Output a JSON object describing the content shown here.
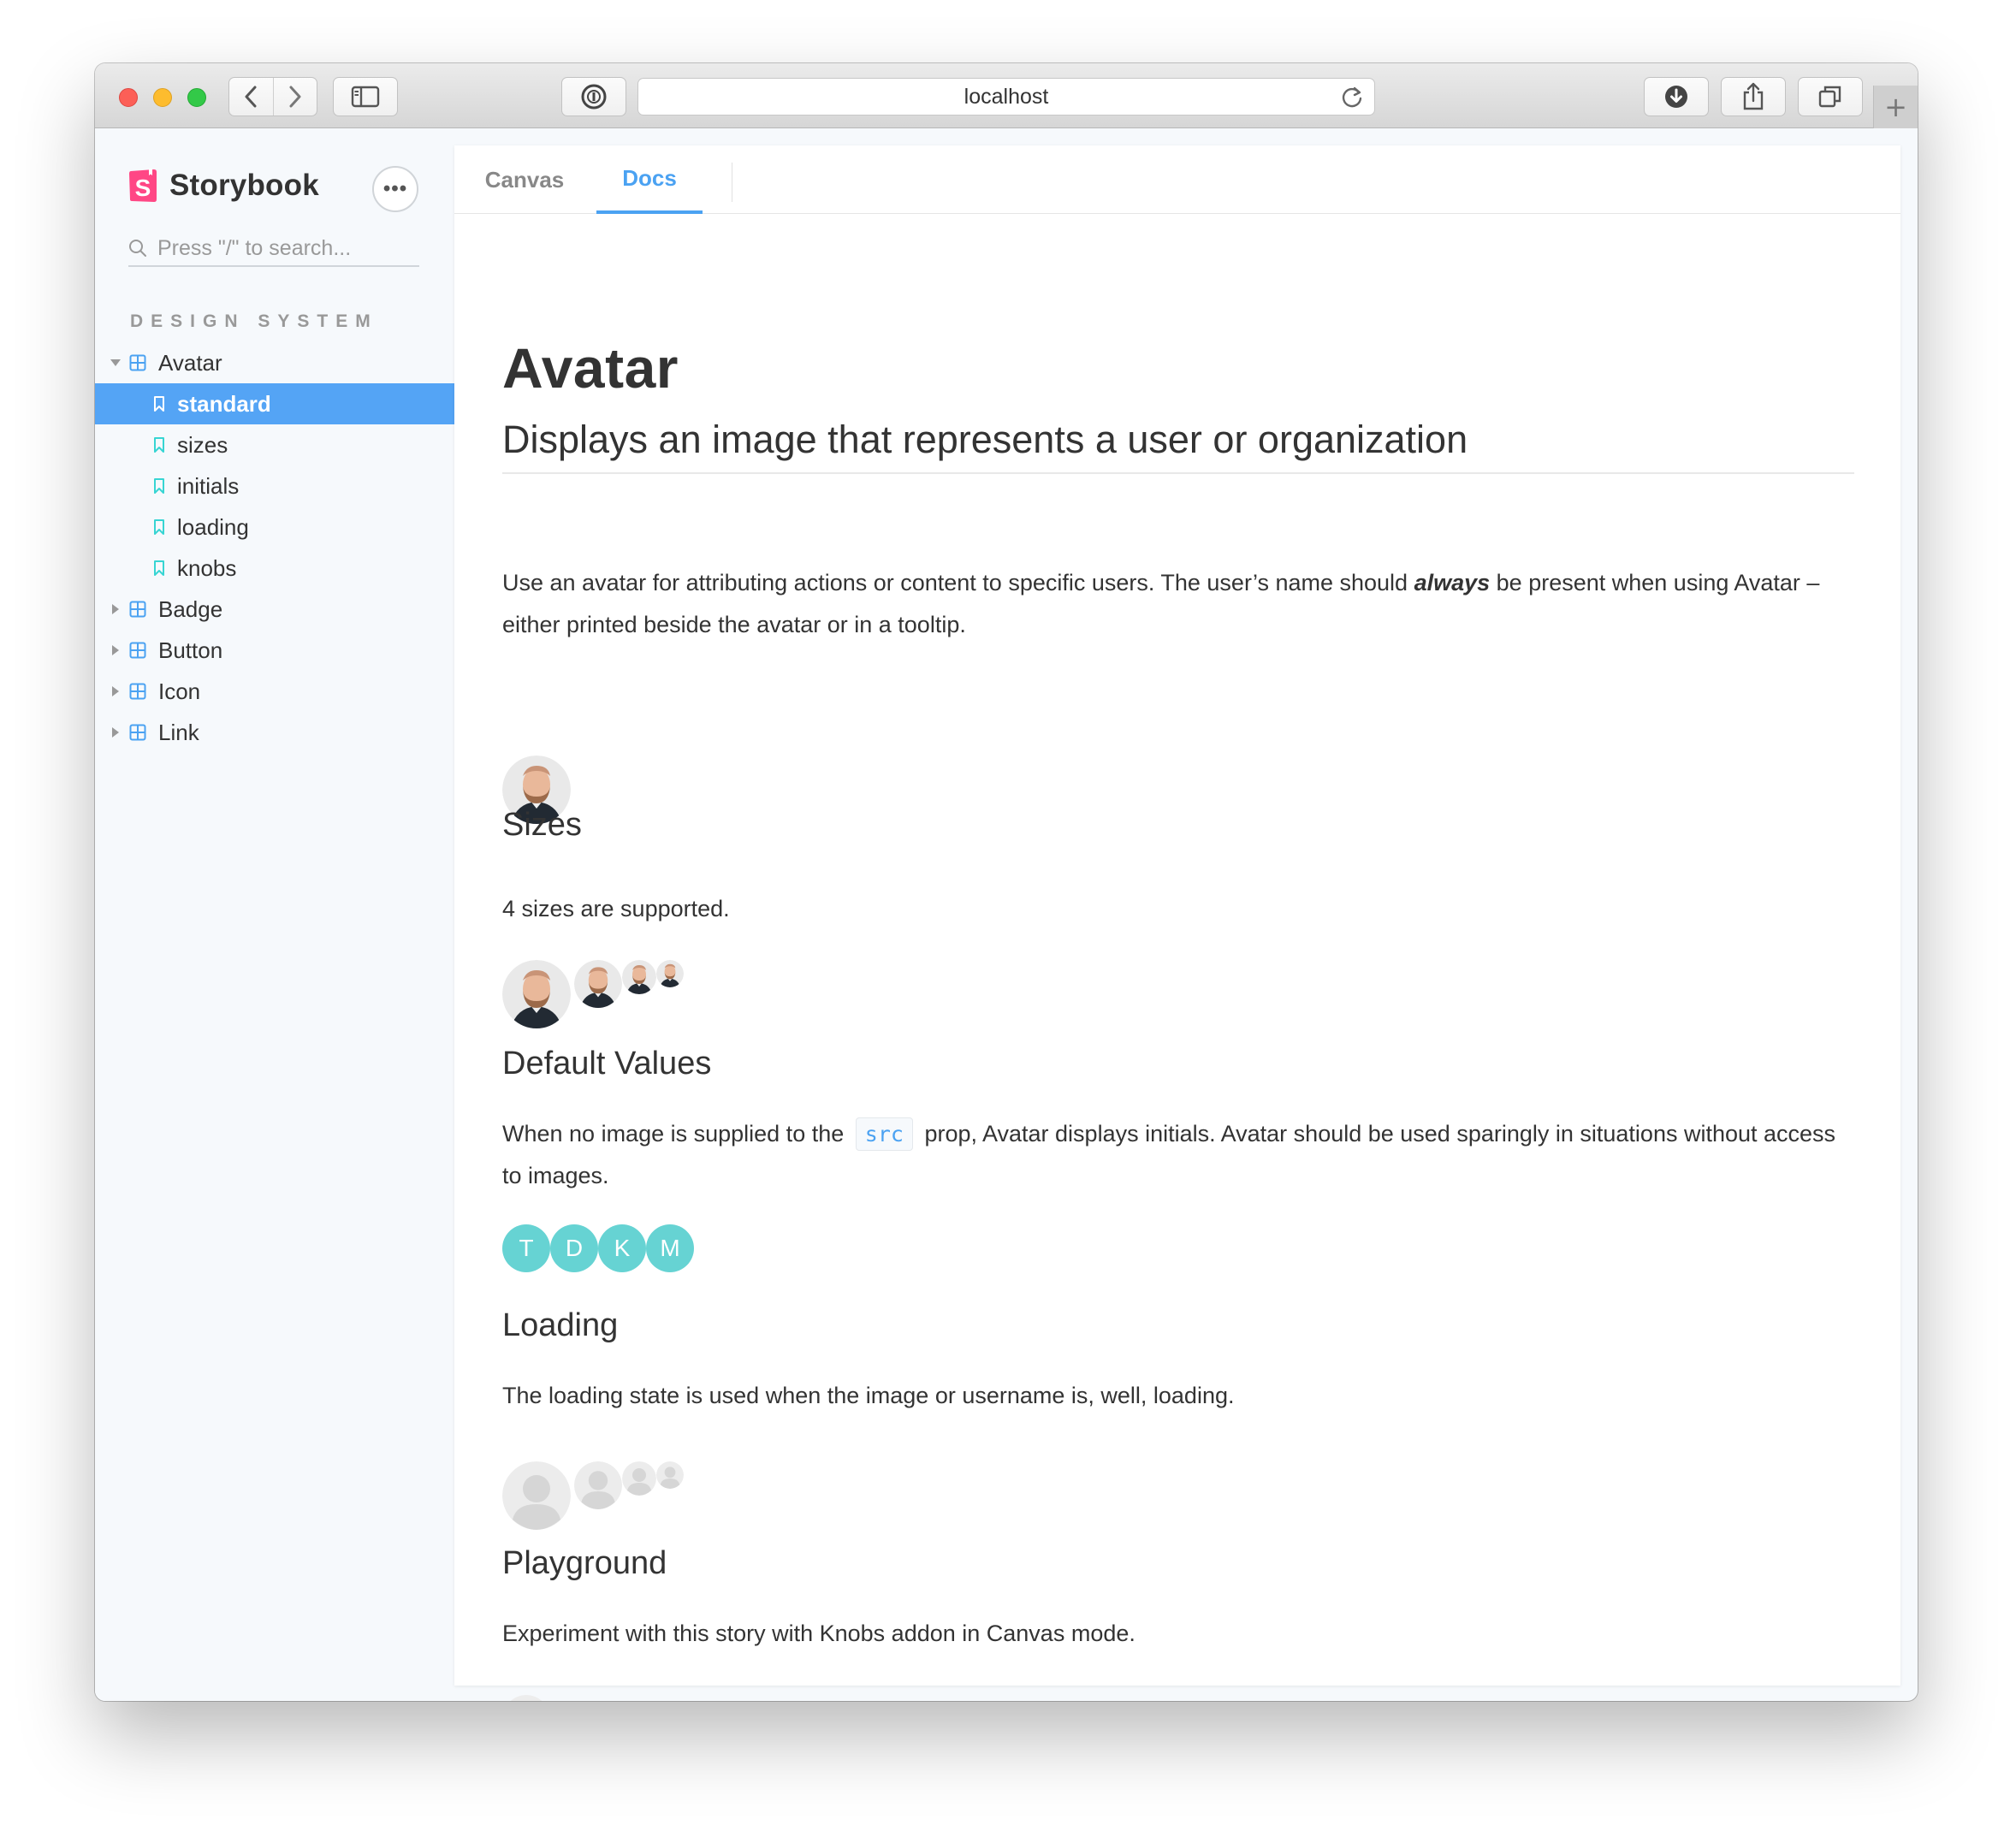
{
  "browser": {
    "address": "localhost"
  },
  "sidebar": {
    "brand": "Storybook",
    "menu_label": "•••",
    "search_placeholder": "Press \"/\" to search...",
    "section": "DESIGN SYSTEM",
    "components": [
      {
        "label": "Avatar",
        "expanded": true,
        "stories": [
          {
            "label": "standard",
            "selected": true
          },
          {
            "label": "sizes",
            "selected": false
          },
          {
            "label": "initials",
            "selected": false
          },
          {
            "label": "loading",
            "selected": false
          },
          {
            "label": "knobs",
            "selected": false
          }
        ]
      },
      {
        "label": "Badge",
        "expanded": false
      },
      {
        "label": "Button",
        "expanded": false
      },
      {
        "label": "Icon",
        "expanded": false
      },
      {
        "label": "Link",
        "expanded": false
      }
    ]
  },
  "tabs": [
    {
      "label": "Canvas",
      "active": false
    },
    {
      "label": "Docs",
      "active": true
    }
  ],
  "doc": {
    "title": "Avatar",
    "subtitle": "Displays an image that represents a user or organization",
    "intro_part1": "Use an avatar for attributing actions or content to specific users. The user’s name should ",
    "intro_emph": "always",
    "intro_part2": " be present when using Avatar – either printed beside the avatar or in a tooltip.",
    "sizes_heading": "Sizes",
    "sizes_text": "4 sizes are supported.",
    "defaults_heading": "Default Values",
    "defaults_part1": "When no image is supplied to the",
    "defaults_code": "src",
    "defaults_part2": "prop, Avatar displays initials. Avatar should be used sparingly in situations without access to images.",
    "initials": [
      "T",
      "D",
      "K",
      "M"
    ],
    "loading_heading": "Loading",
    "loading_text": "The loading state is used when the image or username is, well, loading.",
    "playground_heading": "Playground",
    "playground_text": "Experiment with this story with Knobs addon in Canvas mode."
  },
  "colors": {
    "accent": "#4ba2f2",
    "selected_bg": "#54a4f5",
    "initials_bg": "#66d3d3",
    "brand_pink": "#ff4785"
  }
}
